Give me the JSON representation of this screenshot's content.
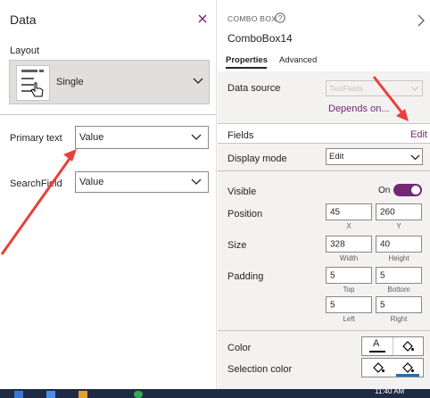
{
  "left_pane": {
    "title": "Data",
    "layout_label": "Layout",
    "layout_value": "Single",
    "primary_text_label": "Primary text",
    "primary_text_value": "Value",
    "searchfield_label": "SearchField",
    "searchfield_value": "Value"
  },
  "right_pane": {
    "control_type": "COMBO BOX",
    "control_name": "ComboBox14",
    "tabs": [
      {
        "label": "Properties",
        "active": true
      },
      {
        "label": "Advanced",
        "active": false
      }
    ],
    "data_source_label": "Data source",
    "data_source_value": "TestFields",
    "depends_on_link": "Depends on...",
    "fields_label": "Fields",
    "fields_edit_link": "Edit",
    "display_mode_label": "Display mode",
    "display_mode_value": "Edit",
    "visible_label": "Visible",
    "visible_state": "On",
    "position_label": "Position",
    "position_x": "45",
    "position_y": "260",
    "position_x_sub": "X",
    "position_y_sub": "Y",
    "size_label": "Size",
    "size_width": "328",
    "size_height": "40",
    "size_width_sub": "Width",
    "size_height_sub": "Height",
    "padding_label": "Padding",
    "padding_top": "5",
    "padding_bottom": "5",
    "padding_left": "5",
    "padding_right": "5",
    "padding_top_sub": "Top",
    "padding_bottom_sub": "Bottom",
    "padding_left_sub": "Left",
    "padding_right_sub": "Right",
    "color_label": "Color",
    "selection_color_label": "Selection color"
  },
  "taskbar": {
    "clock": "11:40 AM"
  },
  "colors": {
    "accent_purple": "#742774",
    "arrow_red": "#e8403a",
    "toggle_purple": "#742774"
  }
}
